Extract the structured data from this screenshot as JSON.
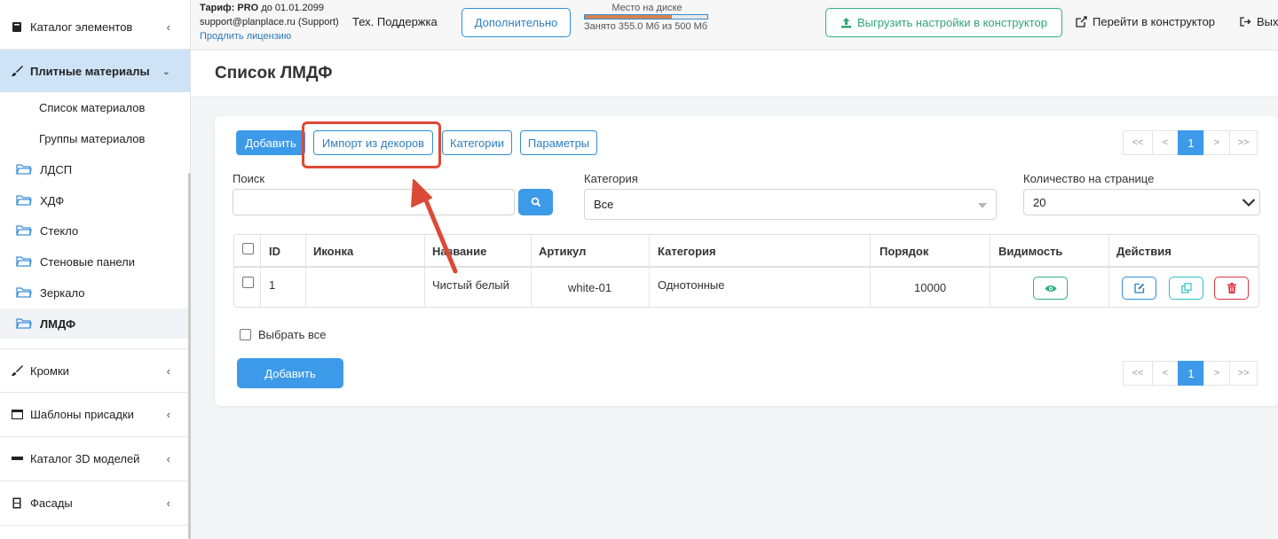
{
  "sidebar": {
    "catalog": "Каталог элементов",
    "plates": "Плитные материалы",
    "sub_items": [
      "Список материалов",
      "Группы материалов"
    ],
    "folders": [
      "ЛДСП",
      "ХДФ",
      "Стекло",
      "Стеновые панели",
      "Зеркало",
      "ЛМДФ"
    ],
    "edges": "Кромки",
    "templates": "Шаблоны присадки",
    "models3d": "Каталог 3D моделей",
    "facades": "Фасады"
  },
  "topbar": {
    "tariff_prefix": "Тариф:",
    "tariff_plan": "PRO",
    "tariff_until": "до 01.01.2099",
    "email": "support@planplace.ru (Support)",
    "extend": "Продлить лицензию",
    "support": "Тех. Поддержка",
    "extra": "Дополнительно",
    "disk_title": "Место на диске",
    "disk_used": "Занято 355.0 Мб из 500 Мб",
    "disk_fraction": 0.71,
    "export": "Выгрузить настройки в конструктор",
    "goto": "Перейти в конструктор",
    "exit": "Вых"
  },
  "page": {
    "title": "Список ЛМДФ"
  },
  "toolbar": {
    "add": "Добавить",
    "import": "Импорт из декоров",
    "categories": "Категории",
    "params": "Параметры"
  },
  "pager": {
    "first": "<<",
    "prev": "<",
    "current": "1",
    "next": ">",
    "last": ">>"
  },
  "filters": {
    "search_label": "Поиск",
    "category_label": "Категория",
    "category_value": "Все",
    "perpage_label": "Количество на странице",
    "perpage_value": "20"
  },
  "table": {
    "headers": [
      "ID",
      "Иконка",
      "Название",
      "Артикул",
      "Категория",
      "Порядок",
      "Видимость",
      "Действия"
    ],
    "rows": [
      {
        "id": "1",
        "icon": "",
        "name": "Чистый белый",
        "article": "white-01",
        "category": "Однотонные",
        "order": "10000"
      }
    ]
  },
  "footer": {
    "select_all": "Выбрать все",
    "add": "Добавить"
  },
  "colors": {
    "primary": "#3d9ae8",
    "highlight": "#dc4a35",
    "success": "#2fb37b",
    "info": "#2ec0c4",
    "danger": "#dc3545"
  }
}
